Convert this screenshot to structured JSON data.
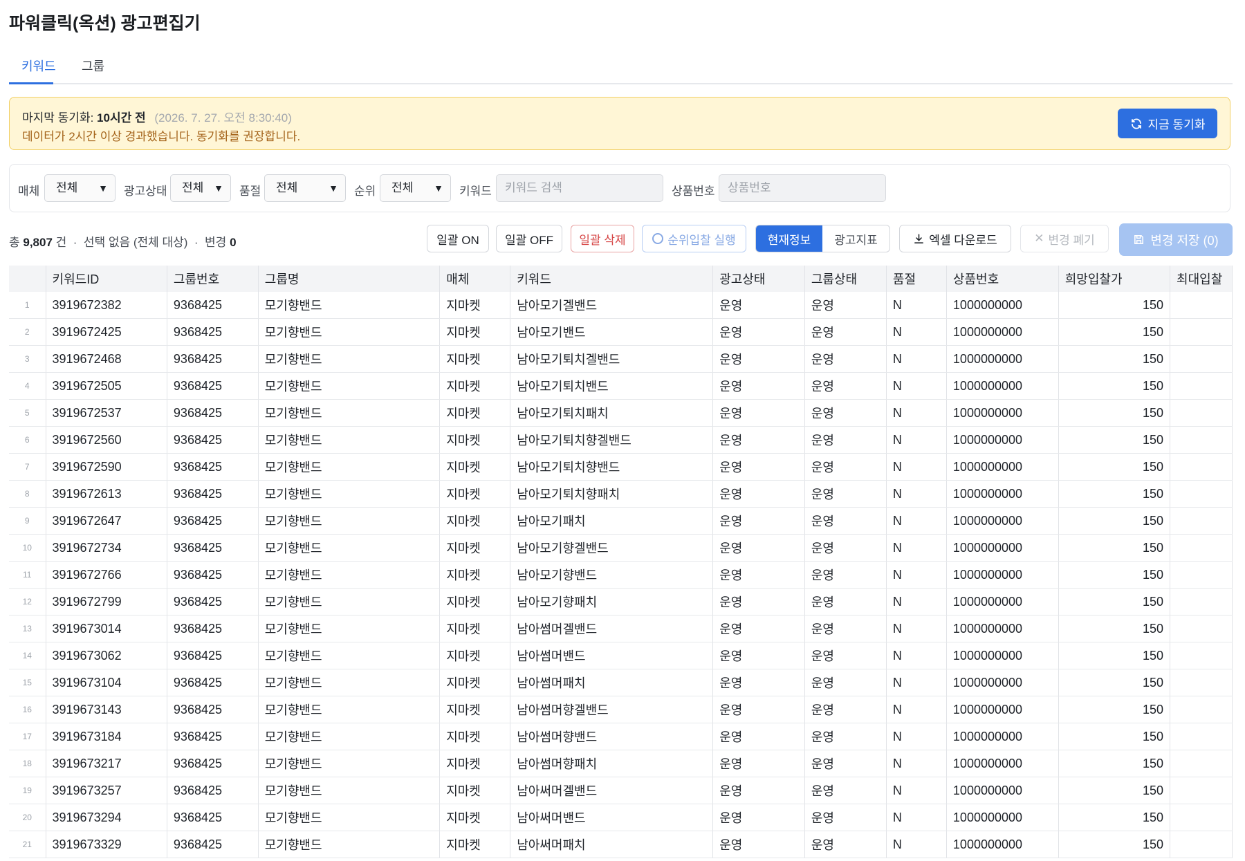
{
  "title": "파워클릭(옥션) 광고편집기",
  "tabs": [
    {
      "label": "키워드",
      "active": true
    },
    {
      "label": "그룹",
      "active": false
    }
  ],
  "sync": {
    "label": "마지막 동기화:",
    "ago": "10시간 전",
    "timestamp": "(2026. 7. 27. 오전 8:30:40)",
    "warning": "데이터가 2시간 이상 경과했습니다. 동기화를 권장합니다.",
    "button": "지금 동기화"
  },
  "filters": {
    "media_label": "매체",
    "media_value": "전체",
    "status_label": "광고상태",
    "status_value": "전체",
    "soldout_label": "품절",
    "soldout_value": "전체",
    "rank_label": "순위",
    "rank_value": "전체",
    "keyword_label": "키워드",
    "keyword_placeholder": "키워드 검색",
    "product_label": "상품번호",
    "product_placeholder": "상품번호"
  },
  "summary": {
    "total_prefix": "총",
    "total": "9,807",
    "total_suffix": "건",
    "selection": "선택 없음 (전체 대상)",
    "changes_label": "변경",
    "changes": "0"
  },
  "toolbar": {
    "bulk_on": "일괄 ON",
    "bulk_off": "일괄 OFF",
    "bulk_delete": "일괄 삭제",
    "rank_bid": "순위입찰 실행",
    "view_current": "현재정보",
    "view_metrics": "광고지표",
    "excel": "엑셀 다운로드",
    "discard": "변경 폐기",
    "save": "변경 저장 (0)"
  },
  "colors": {
    "accent": "#2d6fe0",
    "warning_bg": "#fff6d6",
    "warning_text": "#a4631a",
    "danger": "#d64545"
  },
  "table": {
    "columns": [
      "",
      "키워드ID",
      "그룹번호",
      "그룹명",
      "매체",
      "키워드",
      "광고상태",
      "그룹상태",
      "품절",
      "상품번호",
      "희망입찰가",
      "최대입찰"
    ],
    "rows": [
      [
        "1",
        "3919672382",
        "9368425",
        "모기향밴드",
        "지마켓",
        "남아모기겔밴드",
        "운영",
        "운영",
        "N",
        "1000000000",
        "150",
        ""
      ],
      [
        "2",
        "3919672425",
        "9368425",
        "모기향밴드",
        "지마켓",
        "남아모기밴드",
        "운영",
        "운영",
        "N",
        "1000000000",
        "150",
        ""
      ],
      [
        "3",
        "3919672468",
        "9368425",
        "모기향밴드",
        "지마켓",
        "남아모기퇴치겔밴드",
        "운영",
        "운영",
        "N",
        "1000000000",
        "150",
        ""
      ],
      [
        "4",
        "3919672505",
        "9368425",
        "모기향밴드",
        "지마켓",
        "남아모기퇴치밴드",
        "운영",
        "운영",
        "N",
        "1000000000",
        "150",
        ""
      ],
      [
        "5",
        "3919672537",
        "9368425",
        "모기향밴드",
        "지마켓",
        "남아모기퇴치패치",
        "운영",
        "운영",
        "N",
        "1000000000",
        "150",
        ""
      ],
      [
        "6",
        "3919672560",
        "9368425",
        "모기향밴드",
        "지마켓",
        "남아모기퇴치향겔밴드",
        "운영",
        "운영",
        "N",
        "1000000000",
        "150",
        ""
      ],
      [
        "7",
        "3919672590",
        "9368425",
        "모기향밴드",
        "지마켓",
        "남아모기퇴치향밴드",
        "운영",
        "운영",
        "N",
        "1000000000",
        "150",
        ""
      ],
      [
        "8",
        "3919672613",
        "9368425",
        "모기향밴드",
        "지마켓",
        "남아모기퇴치향패치",
        "운영",
        "운영",
        "N",
        "1000000000",
        "150",
        ""
      ],
      [
        "9",
        "3919672647",
        "9368425",
        "모기향밴드",
        "지마켓",
        "남아모기패치",
        "운영",
        "운영",
        "N",
        "1000000000",
        "150",
        ""
      ],
      [
        "10",
        "3919672734",
        "9368425",
        "모기향밴드",
        "지마켓",
        "남아모기향겔밴드",
        "운영",
        "운영",
        "N",
        "1000000000",
        "150",
        ""
      ],
      [
        "11",
        "3919672766",
        "9368425",
        "모기향밴드",
        "지마켓",
        "남아모기향밴드",
        "운영",
        "운영",
        "N",
        "1000000000",
        "150",
        ""
      ],
      [
        "12",
        "3919672799",
        "9368425",
        "모기향밴드",
        "지마켓",
        "남아모기향패치",
        "운영",
        "운영",
        "N",
        "1000000000",
        "150",
        ""
      ],
      [
        "13",
        "3919673014",
        "9368425",
        "모기향밴드",
        "지마켓",
        "남아썸머겔밴드",
        "운영",
        "운영",
        "N",
        "1000000000",
        "150",
        ""
      ],
      [
        "14",
        "3919673062",
        "9368425",
        "모기향밴드",
        "지마켓",
        "남아썸머밴드",
        "운영",
        "운영",
        "N",
        "1000000000",
        "150",
        ""
      ],
      [
        "15",
        "3919673104",
        "9368425",
        "모기향밴드",
        "지마켓",
        "남아썸머패치",
        "운영",
        "운영",
        "N",
        "1000000000",
        "150",
        ""
      ],
      [
        "16",
        "3919673143",
        "9368425",
        "모기향밴드",
        "지마켓",
        "남아썸머향겔밴드",
        "운영",
        "운영",
        "N",
        "1000000000",
        "150",
        ""
      ],
      [
        "17",
        "3919673184",
        "9368425",
        "모기향밴드",
        "지마켓",
        "남아썸머향밴드",
        "운영",
        "운영",
        "N",
        "1000000000",
        "150",
        ""
      ],
      [
        "18",
        "3919673217",
        "9368425",
        "모기향밴드",
        "지마켓",
        "남아썸머향패치",
        "운영",
        "운영",
        "N",
        "1000000000",
        "150",
        ""
      ],
      [
        "19",
        "3919673257",
        "9368425",
        "모기향밴드",
        "지마켓",
        "남아써머겔밴드",
        "운영",
        "운영",
        "N",
        "1000000000",
        "150",
        ""
      ],
      [
        "20",
        "3919673294",
        "9368425",
        "모기향밴드",
        "지마켓",
        "남아써머밴드",
        "운영",
        "운영",
        "N",
        "1000000000",
        "150",
        ""
      ],
      [
        "21",
        "3919673329",
        "9368425",
        "모기향밴드",
        "지마켓",
        "남아써머패치",
        "운영",
        "운영",
        "N",
        "1000000000",
        "150",
        ""
      ]
    ]
  }
}
